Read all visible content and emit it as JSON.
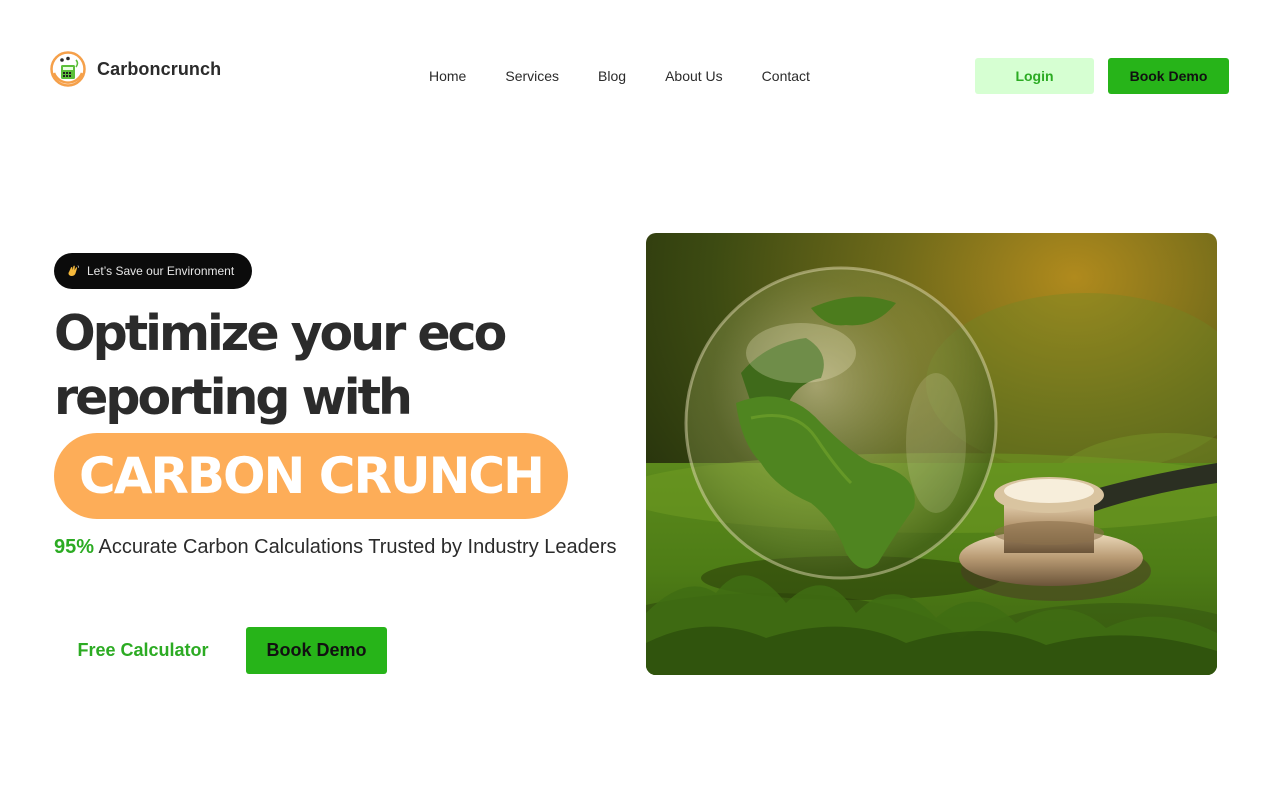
{
  "brand": {
    "name": "Carboncrunch",
    "logo_icon": "carbon-calculator-logo-icon",
    "colors": {
      "orange": "#fdad58",
      "green": "#27b419",
      "green_text": "#2cab23",
      "light_green": "#d6ffd2",
      "dark": "#2b2b2b"
    }
  },
  "nav": {
    "items": [
      {
        "label": "Home"
      },
      {
        "label": "Services"
      },
      {
        "label": "Blog"
      },
      {
        "label": "About Us"
      },
      {
        "label": "Contact"
      }
    ]
  },
  "header": {
    "login_label": "Login",
    "book_demo_label": "Book Demo"
  },
  "hero": {
    "badge_icon": "waving-hand-icon",
    "badge_text": "Let’s Save our Environment",
    "headline_line1": "Optimize your eco",
    "headline_line2": "reporting with",
    "highlight": "CARBON CRUNCH",
    "stat_value": "95%",
    "stat_text": " Accurate Carbon Calculations Trusted by Industry Leaders",
    "free_calculator_label": "Free Calculator",
    "book_demo_label": "Book Demo",
    "image_subject": "glass-globe-on-moss-with-stethoscope"
  }
}
